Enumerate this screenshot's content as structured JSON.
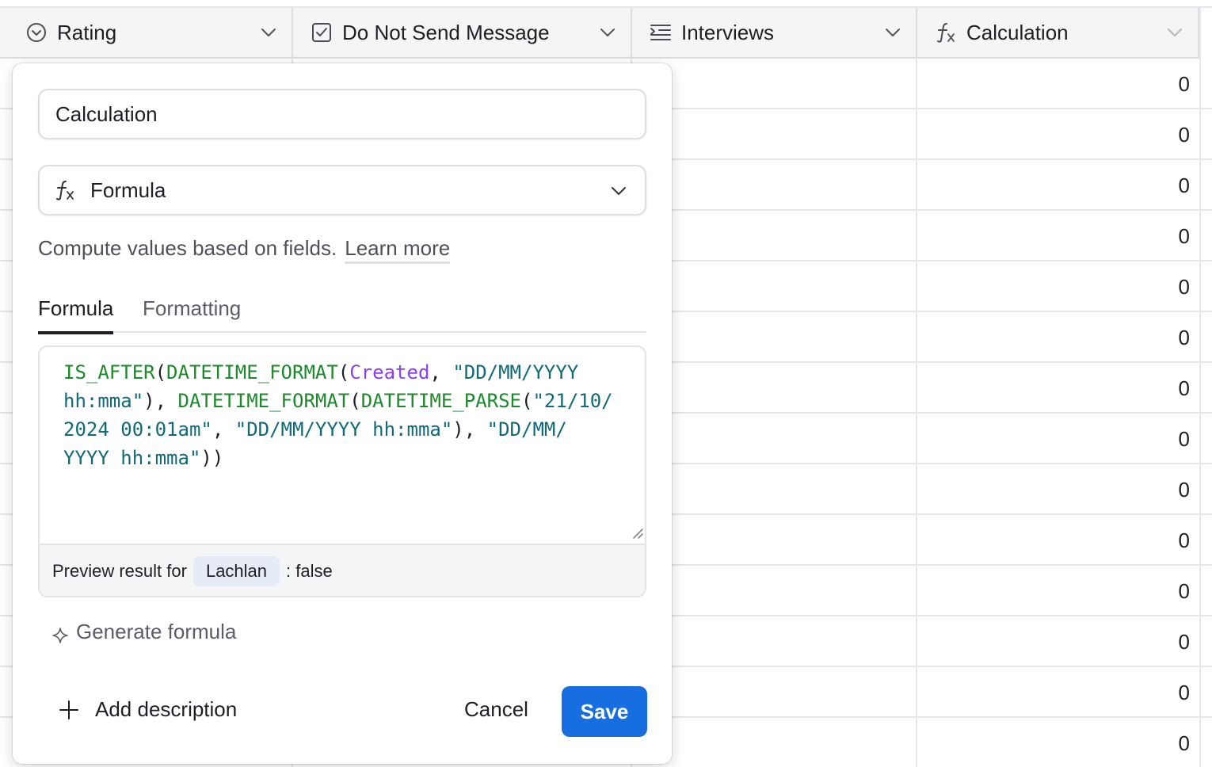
{
  "columns": [
    {
      "label": "Rating",
      "icon": "rating-icon"
    },
    {
      "label": "Do Not Send Message",
      "icon": "checkbox-icon"
    },
    {
      "label": "Interviews",
      "icon": "long-text-icon"
    },
    {
      "label": "Calculation",
      "icon": "formula-icon"
    }
  ],
  "calculation_values": [
    "0",
    "0",
    "0",
    "0",
    "0",
    "0",
    "0",
    "0",
    "0",
    "0",
    "0",
    "0",
    "0",
    "0"
  ],
  "popup": {
    "field_name": "Calculation",
    "field_type": "Formula",
    "helper_text": "Compute values based on fields.",
    "learn_more": "Learn more",
    "tabs": [
      "Formula",
      "Formatting"
    ],
    "formula": {
      "is_after": "IS_AFTER",
      "datetime_format": "DATETIME_FORMAT",
      "datetime_parse": "DATETIME_PARSE",
      "field_ref": "Created",
      "str_format_a": "\"DD/MM/YYYY",
      "str_format_b": "hh:mma\"",
      "str_date_a": "\"21/10/",
      "str_date_b": "2024 00:01am\"",
      "str_format_full": "\"DD/MM/YYYY hh:mma\"",
      "str_format_c": "\"DD/MM/",
      "str_format_d": "YYYY hh:mma\""
    },
    "preview_label": "Preview result for",
    "preview_record": "Lachlan",
    "preview_result": ": false",
    "generate_label": "Generate formula",
    "add_description": "Add description",
    "cancel_label": "Cancel",
    "save_label": "Save",
    "accent_color": "#166ee1"
  }
}
